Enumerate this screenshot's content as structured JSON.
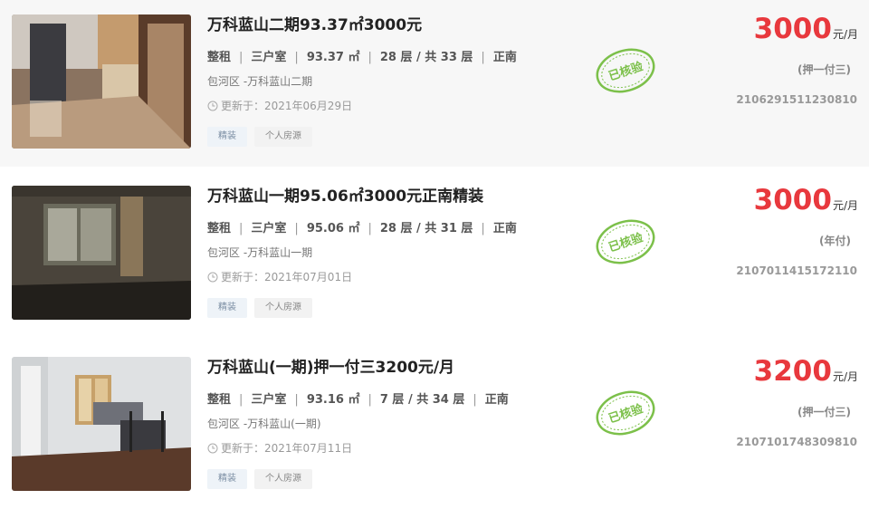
{
  "listings": [
    {
      "title": "万科蓝山二期93.37㎡3000元",
      "rent_type": "整租",
      "rooms": "三户室",
      "area": "93.37 ㎡",
      "floor": "28 层 / 共 33 层",
      "orientation": "正南",
      "location": "包河区 -万科蓝山二期",
      "updated": "更新于：2021年06月29日",
      "tags": [
        "精装",
        "个人房源"
      ],
      "verified_stamp": "已核验",
      "price": "3000",
      "price_unit": "元/月",
      "payment": "(押一付三)",
      "listing_code": "2106291511230810"
    },
    {
      "title": "万科蓝山一期95.06㎡3000元正南精装",
      "rent_type": "整租",
      "rooms": "三户室",
      "area": "95.06 ㎡",
      "floor": "28 层 / 共 31 层",
      "orientation": "正南",
      "location": "包河区 -万科蓝山一期",
      "updated": "更新于：2021年07月01日",
      "tags": [
        "精装",
        "个人房源"
      ],
      "verified_stamp": "已核验",
      "price": "3000",
      "price_unit": "元/月",
      "payment": "(年付)",
      "listing_code": "2107011415172110"
    },
    {
      "title": "万科蓝山(一期)押一付三3200元/月",
      "rent_type": "整租",
      "rooms": "三户室",
      "area": "93.16 ㎡",
      "floor": "7 层 / 共 34 层",
      "orientation": "正南",
      "location": "包河区 -万科蓝山(一期)",
      "updated": "更新于：2021年07月11日",
      "tags": [
        "精装",
        "个人房源"
      ],
      "verified_stamp": "已核验",
      "price": "3200",
      "price_unit": "元/月",
      "payment": "(押一付三)",
      "listing_code": "2107101748309810"
    }
  ],
  "colors": {
    "price": "#e8383d",
    "stamp": "#7cc04a",
    "tag_blue_bg": "#eef3f8"
  },
  "icons": {
    "updated": "clock-icon"
  }
}
